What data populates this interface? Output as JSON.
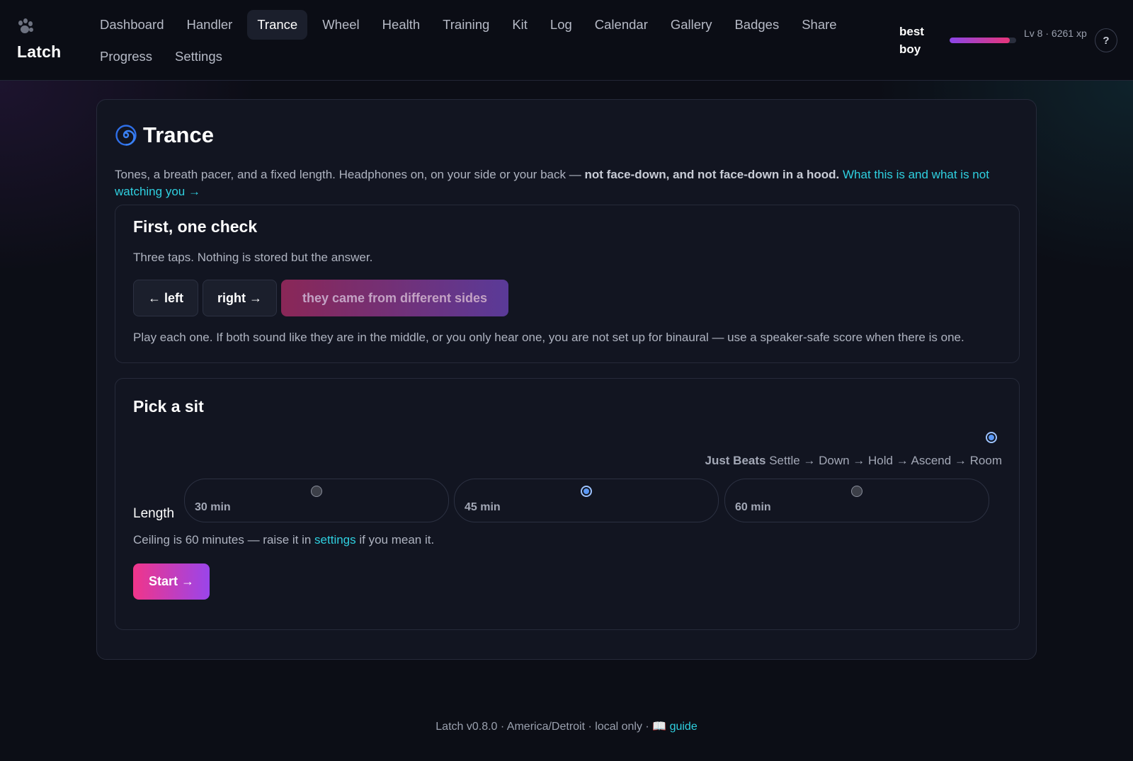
{
  "app": {
    "name": "Latch"
  },
  "nav": {
    "row1": [
      "Dashboard",
      "Handler",
      "Trance",
      "Wheel",
      "Health",
      "Training",
      "Kit",
      "Log",
      "Calendar",
      "Gallery",
      "Badges",
      "Share"
    ],
    "row2": [
      "Progress",
      "Settings"
    ],
    "active": "Trance"
  },
  "user": {
    "name": "best boy",
    "level_text": "Lv 8 · 6261 xp",
    "xp_progress": 0.9,
    "help": "?"
  },
  "colors": {
    "accent": "#2fd0e0",
    "start_from": "#f0358a",
    "start_to": "#9a45ea",
    "radio_on": "#5b98f5"
  },
  "page": {
    "icon": "spiral-icon",
    "title": "Trance",
    "intro_lead": "Tones, a breath pacer, and a fixed length. Headphones on, on your side or your back — ",
    "intro_bold": "not face-down, and not face-down in a hood.",
    "intro_link": "What this is and what is not watching you →"
  },
  "check": {
    "title": "First, one check",
    "subtitle": "Three taps. Nothing is stored but the answer.",
    "left_button": "← left",
    "right_button": "right →",
    "confirm_button": "they came from different sides",
    "note": "Play each one. If both sound like they are in the middle, or you only hear one, you are not set up for binaural — use a speaker-safe score when there is one."
  },
  "sit": {
    "title": "Pick a sit",
    "option_name": "Just Beats",
    "option_flow": "Settle → Down → Hold → Ascend → Room",
    "length_label": "Length",
    "lengths": [
      {
        "label": "30 min",
        "selected": false
      },
      {
        "label": "45 min",
        "selected": true
      },
      {
        "label": "60 min",
        "selected": false
      }
    ],
    "ceiling_lead": "Ceiling is 60 minutes — raise it in ",
    "ceiling_link": "settings",
    "ceiling_tail": " if you mean it.",
    "start_button": "Start →"
  },
  "footer": {
    "text": "Latch v0.8.0 · America/Detroit · local only · ",
    "book_icon": "📖",
    "link": "guide"
  }
}
